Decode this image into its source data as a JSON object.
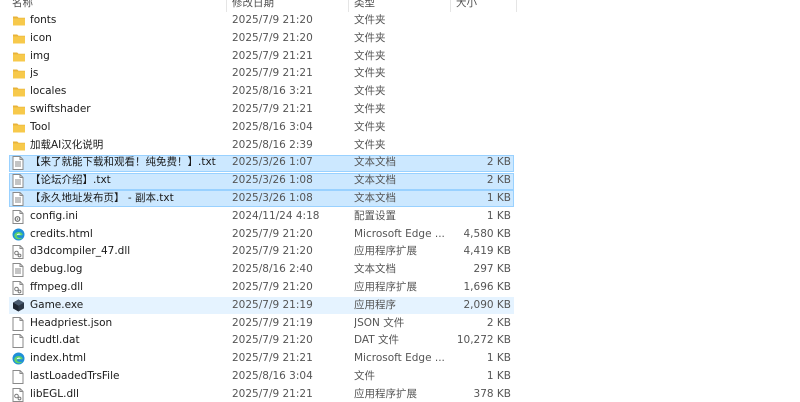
{
  "columns": {
    "name": "名称",
    "date": "修改日期",
    "type": "类型",
    "size": "大小"
  },
  "files": [
    {
      "name": "fonts",
      "date": "2025/7/9 21:20",
      "type": "文件夹",
      "size": "",
      "icon": "folder-icon",
      "state": ""
    },
    {
      "name": "icon",
      "date": "2025/7/9 21:20",
      "type": "文件夹",
      "size": "",
      "icon": "folder-icon",
      "state": ""
    },
    {
      "name": "img",
      "date": "2025/7/9 21:21",
      "type": "文件夹",
      "size": "",
      "icon": "folder-icon",
      "state": ""
    },
    {
      "name": "js",
      "date": "2025/7/9 21:21",
      "type": "文件夹",
      "size": "",
      "icon": "folder-icon",
      "state": ""
    },
    {
      "name": "locales",
      "date": "2025/8/16 3:21",
      "type": "文件夹",
      "size": "",
      "icon": "folder-icon",
      "state": ""
    },
    {
      "name": "swiftshader",
      "date": "2025/7/9 21:21",
      "type": "文件夹",
      "size": "",
      "icon": "folder-icon",
      "state": ""
    },
    {
      "name": "Tool",
      "date": "2025/8/16 3:04",
      "type": "文件夹",
      "size": "",
      "icon": "folder-icon",
      "state": ""
    },
    {
      "name": "加载AI汉化说明",
      "date": "2025/8/16 2:39",
      "type": "文件夹",
      "size": "",
      "icon": "folder-icon",
      "state": ""
    },
    {
      "name": "【来了就能下载和观看！纯免费！】.txt",
      "date": "2025/3/26 1:07",
      "type": "文本文档",
      "size": "2 KB",
      "icon": "text-file-icon",
      "state": "sel"
    },
    {
      "name": "【论坛介绍】.txt",
      "date": "2025/3/26 1:08",
      "type": "文本文档",
      "size": "2 KB",
      "icon": "text-file-icon",
      "state": "sel"
    },
    {
      "name": "【永久地址发布页】 - 副本.txt",
      "date": "2025/3/26 1:08",
      "type": "文本文档",
      "size": "1 KB",
      "icon": "text-file-icon",
      "state": "sel"
    },
    {
      "name": "config.ini",
      "date": "2024/11/24 4:18",
      "type": "配置设置",
      "size": "1 KB",
      "icon": "config-file-icon",
      "state": ""
    },
    {
      "name": "credits.html",
      "date": "2025/7/9 21:20",
      "type": "Microsoft Edge ...",
      "size": "4,580 KB",
      "icon": "edge-icon",
      "state": ""
    },
    {
      "name": "d3dcompiler_47.dll",
      "date": "2025/7/9 21:20",
      "type": "应用程序扩展",
      "size": "4,419 KB",
      "icon": "dll-file-icon",
      "state": ""
    },
    {
      "name": "debug.log",
      "date": "2025/8/16 2:40",
      "type": "文本文档",
      "size": "297 KB",
      "icon": "text-file-icon",
      "state": ""
    },
    {
      "name": "ffmpeg.dll",
      "date": "2025/7/9 21:20",
      "type": "应用程序扩展",
      "size": "1,696 KB",
      "icon": "dll-file-icon",
      "state": ""
    },
    {
      "name": "Game.exe",
      "date": "2025/7/9 21:19",
      "type": "应用程序",
      "size": "2,090 KB",
      "icon": "game-exe-icon",
      "state": "hover"
    },
    {
      "name": "Headpriest.json",
      "date": "2025/7/9 21:19",
      "type": "JSON 文件",
      "size": "2 KB",
      "icon": "blank-file-icon",
      "state": ""
    },
    {
      "name": "icudtl.dat",
      "date": "2025/7/9 21:20",
      "type": "DAT 文件",
      "size": "10,272 KB",
      "icon": "blank-file-icon",
      "state": ""
    },
    {
      "name": "index.html",
      "date": "2025/7/9 21:21",
      "type": "Microsoft Edge ...",
      "size": "1 KB",
      "icon": "edge-icon",
      "state": ""
    },
    {
      "name": "lastLoadedTrsFile",
      "date": "2025/8/16 3:04",
      "type": "文件",
      "size": "1 KB",
      "icon": "blank-file-icon",
      "state": ""
    },
    {
      "name": "libEGL.dll",
      "date": "2025/7/9 21:21",
      "type": "应用程序扩展",
      "size": "378 KB",
      "icon": "dll-file-icon",
      "state": ""
    }
  ],
  "colors": {
    "folder": "#f5c244",
    "selection": "#cce8ff",
    "hover": "#e5f3ff",
    "edge": "#1f8fd8"
  }
}
